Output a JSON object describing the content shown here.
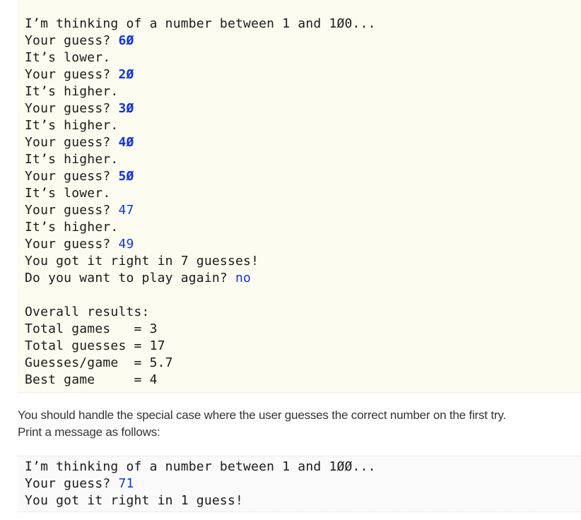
{
  "console_1": {
    "lines": [
      {
        "text": "I’m thinking of a number between 1 and 1Ø0..."
      },
      {
        "text": "Your guess? ",
        "input": "6Ø"
      },
      {
        "text": "It’s lower."
      },
      {
        "text": "Your guess? ",
        "input": "2Ø"
      },
      {
        "text": "It’s higher."
      },
      {
        "text": "Your guess? ",
        "input": "3Ø"
      },
      {
        "text": "It’s higher."
      },
      {
        "text": "Your guess? ",
        "input": "4Ø"
      },
      {
        "text": "It’s higher."
      },
      {
        "text": "Your guess? ",
        "input": "5Ø"
      },
      {
        "text": "It’s lower."
      },
      {
        "text": "Your guess? ",
        "input": "47"
      },
      {
        "text": "It’s higher."
      },
      {
        "text": "Your guess? ",
        "input": "49"
      },
      {
        "text": "You got it right in 7 guesses!"
      },
      {
        "text": "Do you want to play again? ",
        "input": "no"
      }
    ],
    "results": {
      "heading": "Overall results:",
      "rows": [
        {
          "label": "Total games   ",
          "sep": "= ",
          "value": "3"
        },
        {
          "label": "Total guesses ",
          "sep": "= ",
          "value": "17"
        },
        {
          "label": "Guesses/game  ",
          "sep": "= ",
          "value": "5.7"
        },
        {
          "label": "Best game     ",
          "sep": "= ",
          "value": "4"
        }
      ]
    }
  },
  "prose": {
    "line1": "You should handle the special case where the user guesses the correct number on the first try.",
    "line2": "Print a message as follows:"
  },
  "console_2": {
    "lines": [
      {
        "text": "I’m thinking of a number between 1 and 1ØØ..."
      },
      {
        "text": "Your guess? ",
        "input": "71"
      },
      {
        "text": "You got it right in 1 guess!"
      }
    ]
  }
}
